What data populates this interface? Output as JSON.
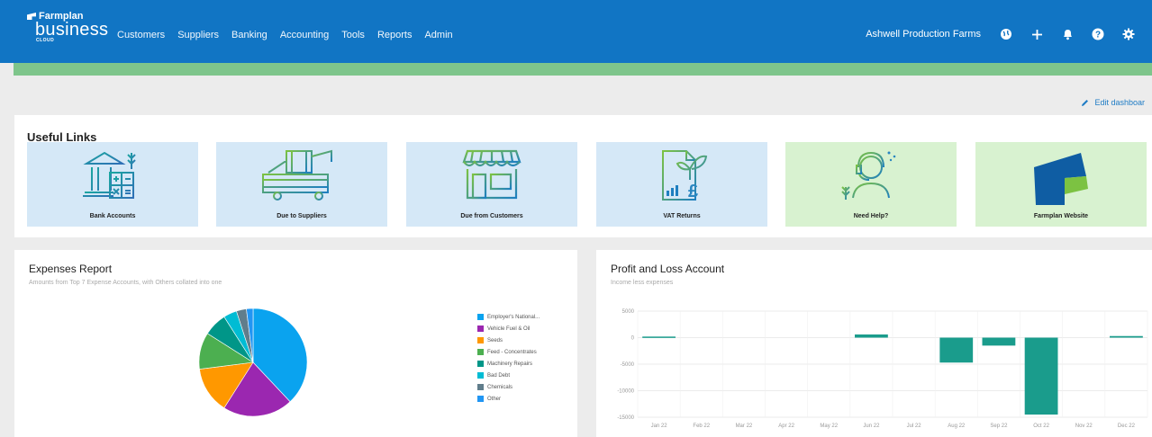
{
  "header": {
    "logo_top": "Farmplan",
    "logo_main": "business",
    "logo_sub": "CLOUD",
    "nav": [
      "Customers",
      "Suppliers",
      "Banking",
      "Accounting",
      "Tools",
      "Reports",
      "Admin"
    ],
    "farm_name": "Ashwell Production Farms",
    "icons": [
      "globe-icon",
      "plus-icon",
      "bell-icon",
      "help-icon",
      "gear-icon"
    ]
  },
  "edit_dashboard": "Edit dashboar",
  "useful_links": {
    "title": "Useful Links",
    "tiles": [
      {
        "label": "Bank Accounts",
        "icon": "bank-calculator-icon",
        "color": "blue"
      },
      {
        "label": "Due to Suppliers",
        "icon": "combine-harvester-icon",
        "color": "blue"
      },
      {
        "label": "Due from Customers",
        "icon": "shop-icon",
        "color": "blue"
      },
      {
        "label": "VAT Returns",
        "icon": "vat-document-icon",
        "color": "blue"
      },
      {
        "label": "Need Help?",
        "icon": "support-agent-icon",
        "color": "green"
      },
      {
        "label": "Farmplan Website",
        "icon": "farmplan-logo-icon",
        "color": "green"
      }
    ]
  },
  "expenses": {
    "title": "Expenses Report",
    "subtitle": "Amounts from Top 7 Expense Accounts, with Others collated into one",
    "chart_data": {
      "type": "pie",
      "labels": [
        "Employer's National...",
        "Vehicle Fuel & Oil",
        "Seeds",
        "Feed - Concentrates",
        "Machinery Repairs",
        "Bad Debt",
        "Chemicals",
        "Other"
      ],
      "values": [
        38,
        21,
        14,
        11,
        7,
        4,
        3,
        2
      ],
      "colors": [
        "#0aa3ef",
        "#9b27b0",
        "#ff9800",
        "#4caf50",
        "#009688",
        "#00bcd4",
        "#607d8b",
        "#2196f3"
      ],
      "legend": "right"
    }
  },
  "pnl": {
    "title": "Profit and Loss Account",
    "subtitle": "Income less expenses",
    "chart_data": {
      "type": "bar",
      "categories": [
        "Jan 22",
        "Feb 22",
        "Mar 22",
        "Apr 22",
        "May 22",
        "Jun 22",
        "Jul 22",
        "Aug 22",
        "Sep 22",
        "Oct 22",
        "Nov 22",
        "Dec 22"
      ],
      "values": [
        200,
        0,
        0,
        0,
        0,
        600,
        0,
        -4700,
        -1500,
        -14500,
        0,
        300
      ],
      "ylim": [
        -15000,
        5000
      ],
      "yticks": [
        "5000",
        "0",
        "-5000",
        "-10000",
        "-15000"
      ],
      "bar_color": "#1a9c8c",
      "grid": true
    }
  }
}
